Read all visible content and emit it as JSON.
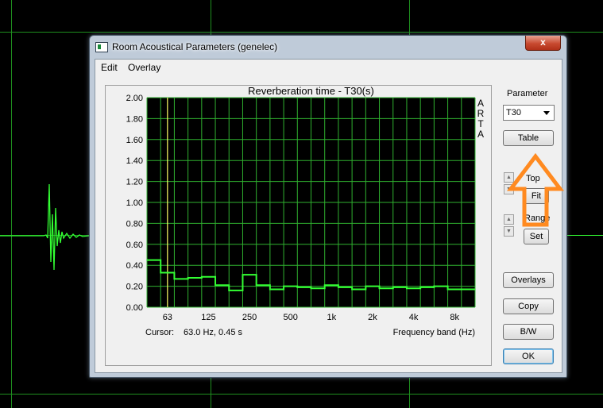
{
  "window": {
    "title": "Room Acoustical Parameters (genelec)",
    "close_glyph": "x"
  },
  "menu": [
    "Edit",
    "Overlay"
  ],
  "chart_data": {
    "type": "line",
    "title": "Reverberation time - T30(s)",
    "xlabel": "Frequency band (Hz)",
    "ylabel": "",
    "watermark": "ARTA",
    "ylim": [
      0,
      2
    ],
    "y_ticks": [
      "0.00",
      "0.20",
      "0.40",
      "0.60",
      "0.80",
      "1.00",
      "1.20",
      "1.40",
      "1.60",
      "1.80",
      "2.00"
    ],
    "x_ticks": [
      "63",
      "125",
      "250",
      "500",
      "1k",
      "2k",
      "4k",
      "8k"
    ],
    "style": "step",
    "grid": true,
    "bands": [
      "50",
      "63",
      "80",
      "100",
      "125",
      "160",
      "200",
      "250",
      "315",
      "400",
      "500",
      "630",
      "800",
      "1k",
      "1.25k",
      "1.6k",
      "2k",
      "2.5k",
      "3.15k",
      "4k",
      "5k",
      "6.3k",
      "8k",
      "10k"
    ],
    "values": [
      0.45,
      0.33,
      0.27,
      0.28,
      0.29,
      0.21,
      0.16,
      0.31,
      0.21,
      0.17,
      0.2,
      0.19,
      0.18,
      0.21,
      0.19,
      0.17,
      0.2,
      0.18,
      0.19,
      0.18,
      0.19,
      0.2,
      0.17,
      0.17
    ],
    "cursor": {
      "band": "63",
      "value": 0.45
    },
    "colors": {
      "background": "#000000",
      "grid": "#2fb02f",
      "trace": "#33ff33",
      "cursor": "#ffff66"
    }
  },
  "cursor_readout": {
    "label": "Cursor:",
    "value": "63.0 Hz, 0.45 s"
  },
  "sidebar": {
    "parameter_label": "Parameter",
    "parameter_value": "T30",
    "table_btn": "Table",
    "top_label": "Top",
    "fit_btn": "Fit",
    "range_label": "Range",
    "set_btn": "Set",
    "overlays_btn": "Overlays",
    "copy_btn": "Copy",
    "bw_btn": "B/W",
    "ok_btn": "OK"
  },
  "annotation": {
    "color": "#ff8a20"
  }
}
